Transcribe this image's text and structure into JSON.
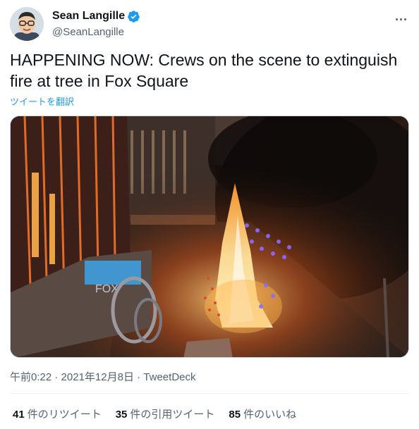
{
  "author": {
    "name": "Sean Langille",
    "handle": "@SeanLangille",
    "verified": true
  },
  "tweet": {
    "text": "HAPPENING NOW: Crews on the scene to extinguish fire at tree in Fox Square",
    "translate_label": "ツイートを翻訳",
    "time": "午前0:22",
    "separator": "·",
    "date": "2021年12月8日",
    "source": "TweetDeck"
  },
  "stats": {
    "retweets": {
      "count": "41",
      "label": "件のリツイート"
    },
    "quotes": {
      "count": "35",
      "label": "件の引用ツイート"
    },
    "likes": {
      "count": "85",
      "label": "件のいいね"
    }
  },
  "colors": {
    "accent": "#1d9bf0",
    "verified_badge": "#1d9bf0",
    "text_primary": "#0f1419",
    "text_secondary": "#536471"
  },
  "icons": {
    "verified": "verified-badge-icon",
    "more": "more-options-icon"
  }
}
